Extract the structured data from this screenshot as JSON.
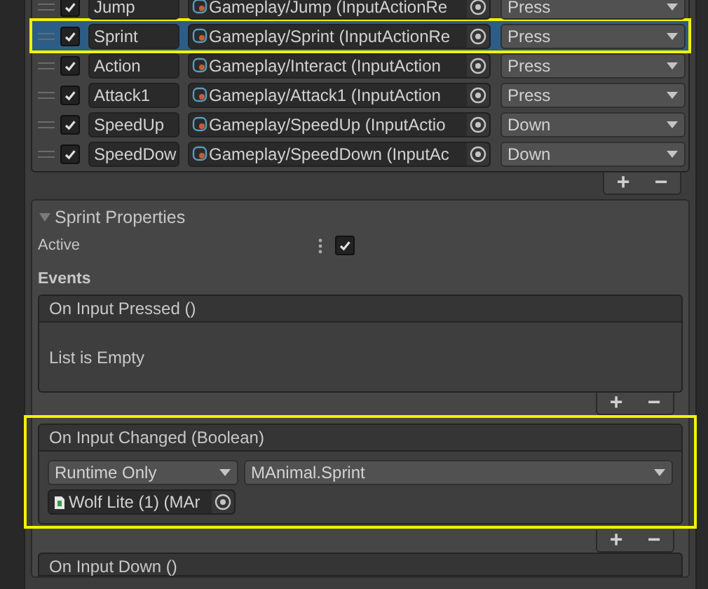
{
  "bindings": [
    {
      "enabled": true,
      "name": "Jump",
      "action": "Gameplay/Jump (InputActionRe",
      "interaction": "Press",
      "selected": false,
      "highlighted": false
    },
    {
      "enabled": true,
      "name": "Sprint",
      "action": "Gameplay/Sprint (InputActionRe",
      "interaction": "Press",
      "selected": true,
      "highlighted": true
    },
    {
      "enabled": true,
      "name": "Action",
      "action": "Gameplay/Interact (InputAction",
      "interaction": "Press",
      "selected": false,
      "highlighted": false
    },
    {
      "enabled": true,
      "name": "Attack1",
      "action": "Gameplay/Attack1 (InputAction",
      "interaction": "Press",
      "selected": false,
      "highlighted": false
    },
    {
      "enabled": true,
      "name": "SpeedUp",
      "action": "Gameplay/SpeedUp (InputActio",
      "interaction": "Down",
      "selected": false,
      "highlighted": false
    },
    {
      "enabled": true,
      "name": "SpeedDow",
      "action": "Gameplay/SpeedDown (InputAc",
      "interaction": "Down",
      "selected": false,
      "highlighted": false
    }
  ],
  "bindings_footer": {
    "add": "+",
    "remove": "−"
  },
  "properties": {
    "title": "Sprint Properties",
    "expanded": true,
    "active_label": "Active",
    "active": true,
    "events_label": "Events",
    "events": [
      {
        "title": "On Input Pressed ()",
        "empty_text": "List is Empty",
        "highlighted": false,
        "footer": {
          "add": "+",
          "remove": "−"
        }
      },
      {
        "title": "On Input Changed (Boolean)",
        "highlighted": true,
        "listeners": [
          {
            "mode": "Runtime Only",
            "function": "MAnimal.Sprint",
            "target": "Wolf Lite (1) (MAr"
          }
        ],
        "footer": {
          "add": "+",
          "remove": "−"
        }
      },
      {
        "title": "On Input Down ()",
        "highlighted": false
      }
    ]
  }
}
